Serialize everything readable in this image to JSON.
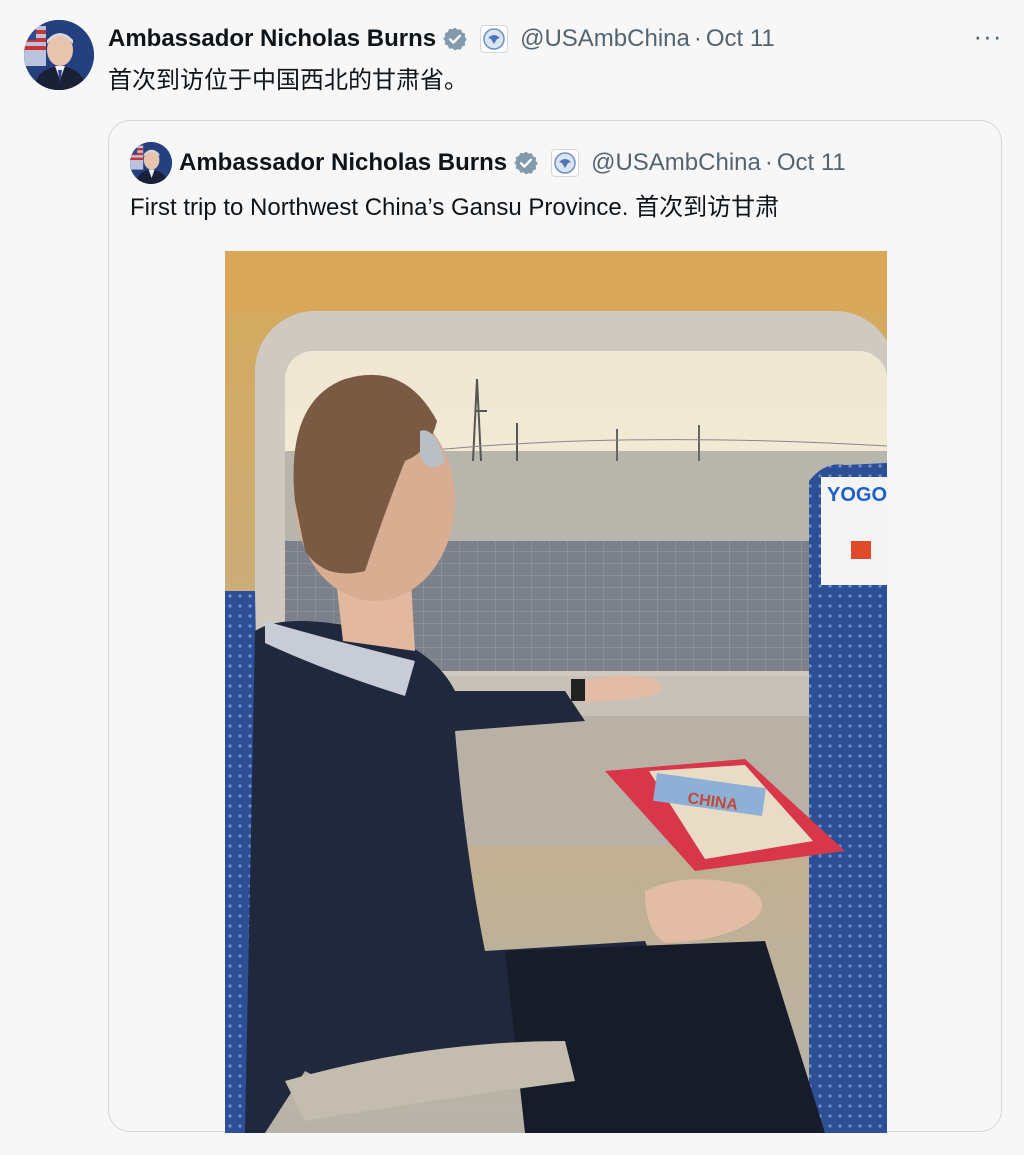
{
  "post": {
    "author_name": "Ambassador Nicholas Burns",
    "handle": "@USAmbChina",
    "separator": "·",
    "date": "Oct 11",
    "more_icon": "···",
    "text": "首次到访位于中国西北的甘肃省。",
    "verified_icon": "verified-badge-icon",
    "affiliation_icon": "embassy-seal-icon"
  },
  "quoted_post": {
    "author_name": "Ambassador Nicholas Burns",
    "handle": "@USAmbChina",
    "separator": "·",
    "date": "Oct 11",
    "text": "First trip to Northwest China’s Gansu Province.  首次到访甘肃"
  },
  "photo": {
    "book_title": "CHINA",
    "seat_card_text": "YOGO"
  },
  "colors": {
    "background": "#f7f7f7",
    "text": "#0f1419",
    "secondary": "#536471",
    "verified": "#829aab",
    "border": "#cfd9de"
  }
}
